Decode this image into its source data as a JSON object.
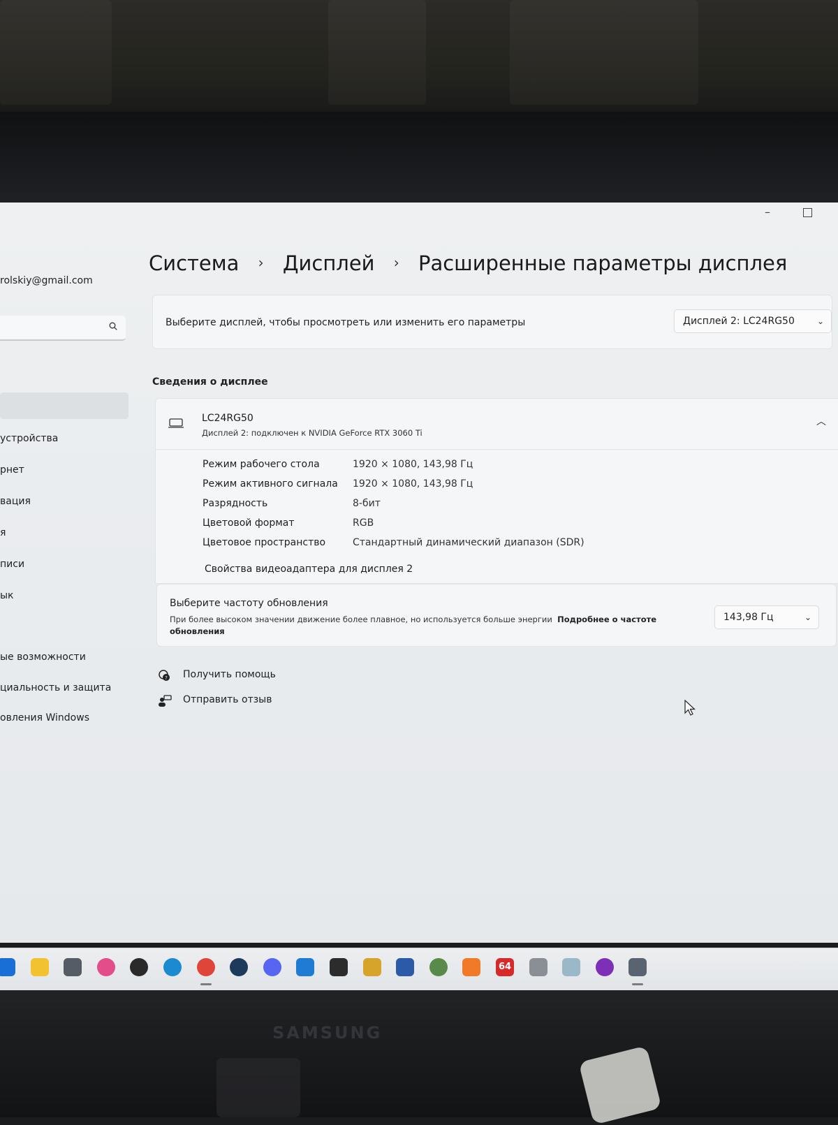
{
  "window": {
    "minimize_glyph": "–",
    "maximize_glyph": ""
  },
  "sidebar": {
    "email": "rolskiy@gmail.com",
    "items": [
      {
        "label": "устройства"
      },
      {
        "label": "рнет"
      },
      {
        "label": "вация"
      },
      {
        "label": "я"
      },
      {
        "label": "писи"
      },
      {
        "label": "ык"
      },
      {
        "label": "ые возможности"
      },
      {
        "label": "циальность и защита"
      },
      {
        "label": "овления Windows"
      }
    ]
  },
  "breadcrumb": {
    "items": [
      "Система",
      "Дисплей",
      "Расширенные параметры дисплея"
    ],
    "separator": "›"
  },
  "display_select": {
    "label": "Выберите дисплей, чтобы просмотреть или изменить его параметры",
    "value": "Дисплей 2: LC24RG50"
  },
  "info_section": {
    "title": "Сведения о дисплее",
    "monitor_name": "LC24RG50",
    "monitor_subtitle": "Дисплей 2: подключен к NVIDIA GeForce RTX 3060 Ti",
    "rows": [
      {
        "label": "Режим рабочего стола",
        "value": "1920 × 1080, 143,98 Гц"
      },
      {
        "label": "Режим активного сигнала",
        "value": "1920 × 1080, 143,98 Гц"
      },
      {
        "label": "Разрядность",
        "value": "8-бит"
      },
      {
        "label": "Цветовой формат",
        "value": "RGB"
      },
      {
        "label": "Цветовое пространство",
        "value": "Стандартный динамический диапазон (SDR)"
      }
    ],
    "adapter_link": "Свойства видеоадаптера для дисплея 2"
  },
  "refresh": {
    "title": "Выберите частоту обновления",
    "description": "При более высоком значении движение более плавное, но используется больше энергии",
    "link": "Подробнее о частоте обновления",
    "value": "143,98 Гц"
  },
  "help": {
    "get_help": "Получить помощь",
    "feedback": "Отправить отзыв"
  },
  "monitor_brand": "SAMSUNG",
  "colors": {
    "screen_bg": "#eceef0",
    "card_bg": "#f5f6f7",
    "taskbar_bg": "#e6e9ec"
  },
  "taskbar": {
    "icons": [
      {
        "name": "start-icon",
        "color": "#1a6fd6"
      },
      {
        "name": "file-explorer-icon",
        "color": "#f2c230"
      },
      {
        "name": "notepad-icon",
        "color": "#555c66"
      },
      {
        "name": "osu-icon",
        "color": "#e34d8a"
      },
      {
        "name": "obs-icon",
        "color": "#2a2a2a"
      },
      {
        "name": "edge-icon",
        "color": "#1b8ad0"
      },
      {
        "name": "chrome-icon",
        "color": "#e0453a"
      },
      {
        "name": "steam-icon",
        "color": "#1d3a5c"
      },
      {
        "name": "discord-icon",
        "color": "#5865f2"
      },
      {
        "name": "vscode-icon",
        "color": "#1f7bd3"
      },
      {
        "name": "epic-games-icon",
        "color": "#2c2c2c"
      },
      {
        "name": "m-app-icon",
        "color": "#d6a42b"
      },
      {
        "name": "powershell-icon",
        "color": "#2c5aa8"
      },
      {
        "name": "xbox-icon",
        "color": "#5a8a4a"
      },
      {
        "name": "app-orange-icon",
        "color": "#f07a28"
      },
      {
        "name": "aida64-icon",
        "color": "#d62a2a"
      },
      {
        "name": "database-icon",
        "color": "#8a8f95"
      },
      {
        "name": "eye-icon",
        "color": "#9ab8c8"
      },
      {
        "name": "tor-icon",
        "color": "#7d2fb8"
      },
      {
        "name": "settings-icon",
        "color": "#5a6470"
      }
    ],
    "label_64": "64"
  }
}
